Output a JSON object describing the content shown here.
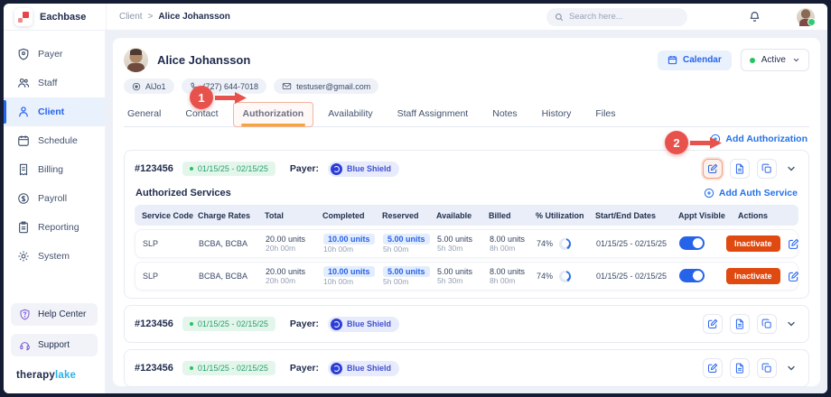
{
  "brand": {
    "name": "Eachbase",
    "footer_primary": "therapy",
    "footer_accent": "lake"
  },
  "header": {
    "breadcrumb_section": "Client",
    "breadcrumb_separator": ">",
    "breadcrumb_current": "Alice Johansson",
    "search_placeholder": "Search here..."
  },
  "sidebar": {
    "items": [
      {
        "label": "Payer",
        "icon": "shield-icon"
      },
      {
        "label": "Staff",
        "icon": "people-icon"
      },
      {
        "label": "Client",
        "icon": "person-icon",
        "active": true
      },
      {
        "label": "Schedule",
        "icon": "calendar-icon"
      },
      {
        "label": "Billing",
        "icon": "invoice-icon"
      },
      {
        "label": "Payroll",
        "icon": "money-icon"
      },
      {
        "label": "Reporting",
        "icon": "clipboard-icon"
      },
      {
        "label": "System",
        "icon": "gear-icon"
      }
    ],
    "footer": [
      {
        "label": "Help Center",
        "icon": "help-badge-icon"
      },
      {
        "label": "Support",
        "icon": "headset-icon"
      }
    ]
  },
  "client": {
    "name": "Alice Johansson",
    "code": "AlJo1",
    "phone": "(727) 644-7018",
    "email": "testuser@gmail.com",
    "calendar_button": "Calendar",
    "status": "Active"
  },
  "tabs": [
    {
      "label": "General"
    },
    {
      "label": "Contact"
    },
    {
      "label": "Authorization",
      "active": true
    },
    {
      "label": "Availability"
    },
    {
      "label": "Staff Assignment"
    },
    {
      "label": "Notes"
    },
    {
      "label": "History"
    },
    {
      "label": "Files"
    }
  ],
  "authorization": {
    "add_authorization_label": "Add Authorization",
    "authorized_services_title": "Authorized Services",
    "add_auth_service_label": "Add Auth Service",
    "cards": [
      {
        "number": "#123456",
        "date_range": "01/15/25 - 02/15/25",
        "payer_label": "Payer:",
        "payer_name": "Blue Shield",
        "expanded": true
      },
      {
        "number": "#123456",
        "date_range": "01/15/25 - 02/15/25",
        "payer_label": "Payer:",
        "payer_name": "Blue Shield",
        "expanded": false
      },
      {
        "number": "#123456",
        "date_range": "01/15/25 - 02/15/25",
        "payer_label": "Payer:",
        "payer_name": "Blue Shield",
        "expanded": false
      }
    ],
    "table": {
      "columns": [
        "Service Code",
        "Charge Rates",
        "Total",
        "Completed",
        "Reserved",
        "Available",
        "Billed",
        "% Utilization",
        "Start/End Dates",
        "Appt Visible",
        "Actions"
      ],
      "rows": [
        {
          "service_code": "SLP",
          "charge_rates": "BCBA, BCBA",
          "total_units": "20.00 units",
          "total_time": "20h 00m",
          "completed_units": "10.00 units",
          "completed_time": "10h 00m",
          "reserved_units": "5.00 units",
          "reserved_time": "5h 00m",
          "available_units": "5.00 units",
          "available_time": "5h 30m",
          "billed_units": "8.00 units",
          "billed_time": "8h 00m",
          "utilization": "74%",
          "utilization_pct": 74,
          "start_end_dates": "01/15/25 - 02/15/25",
          "appt_visible": true,
          "inactivate_label": "Inactivate"
        },
        {
          "service_code": "SLP",
          "charge_rates": "BCBA, BCBA",
          "total_units": "20.00 units",
          "total_time": "20h 00m",
          "completed_units": "10.00 units",
          "completed_time": "10h 00m",
          "reserved_units": "5.00 units",
          "reserved_time": "5h 00m",
          "available_units": "5.00 units",
          "available_time": "5h 30m",
          "billed_units": "8.00 units",
          "billed_time": "8h 00m",
          "utilization": "74%",
          "utilization_pct": 74,
          "start_end_dates": "01/15/25 - 02/15/25",
          "appt_visible": true,
          "inactivate_label": "Inactivate"
        }
      ]
    }
  },
  "annotations": [
    {
      "number": "1"
    },
    {
      "number": "2"
    }
  ],
  "icons": {
    "search-icon": "magnifier",
    "bell-icon": "bell",
    "plus-circle-icon": "circled plus",
    "edit-icon": "pencil in square",
    "document-icon": "file",
    "copy-icon": "overlapping squares",
    "chevron-down-icon": "down chevron",
    "location-badge-icon": "round badge",
    "phone-icon": "handset",
    "email-icon": "envelope"
  },
  "colors": {
    "accent_blue": "#2563eb",
    "annotation_red": "#e8524c",
    "tab_underline_orange": "#f6a53b",
    "inactivate_orange": "#e0490f",
    "status_green": "#22c55e",
    "payer_chip_blue": "#3f51d0"
  }
}
